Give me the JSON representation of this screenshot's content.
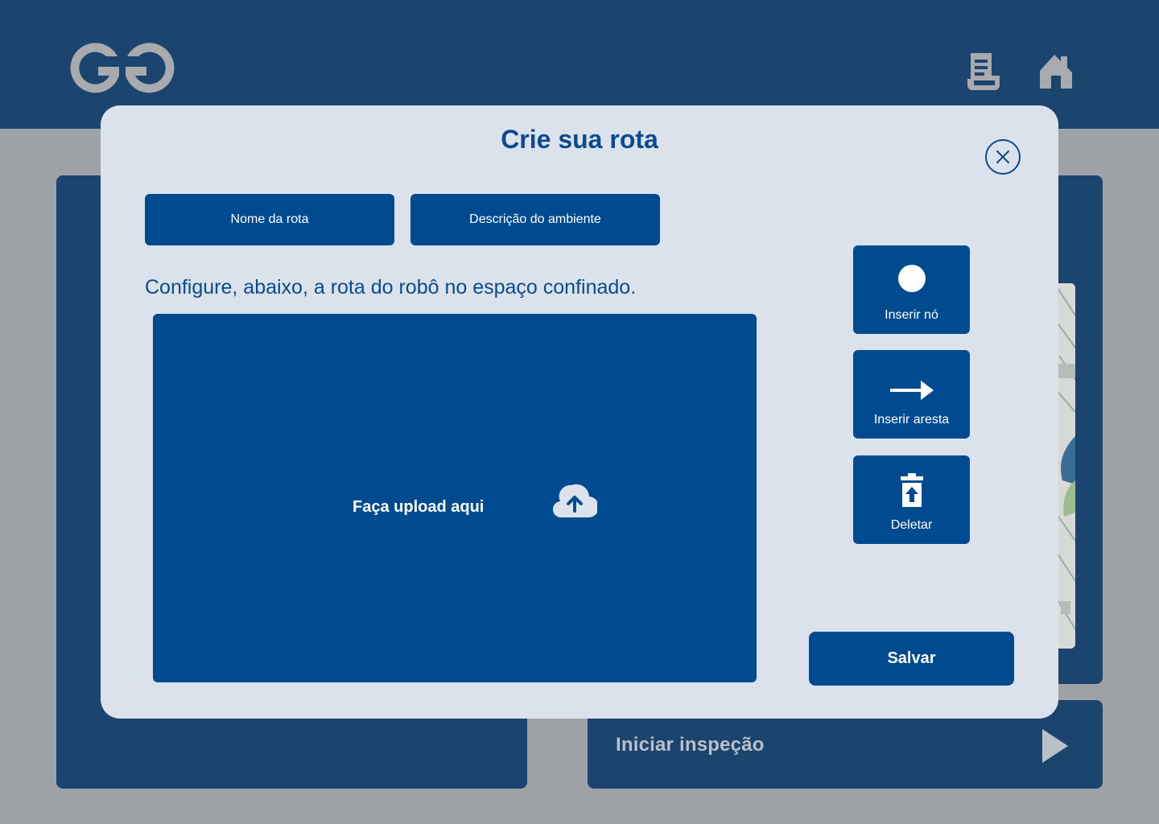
{
  "header": {
    "logo_icon": "gg-logo-icon",
    "reports_icon": "document-icon",
    "home_icon": "home-icon",
    "bar_color": "#1b446f"
  },
  "background": {
    "start_inspection_label": "Iniciar inspeção",
    "start_icon": "play-icon"
  },
  "modal": {
    "title": "Crie sua rota",
    "close_icon": "close-icon",
    "fields": {
      "route_name": "Nome da rota",
      "environment_description": "Descrição do ambiente"
    },
    "instructions": "Configure, abaixo, a rota do robô no espaço confinado.",
    "upload": {
      "label": "Faça upload aqui",
      "icon": "cloud-upload-icon"
    },
    "tools": {
      "insert_node": "Inserir nó",
      "insert_edge": "Inserir aresta",
      "delete": "Deletar"
    },
    "save_label": "Salvar",
    "accent_color": "#004b8f",
    "background_color": "#dbe2eb"
  }
}
